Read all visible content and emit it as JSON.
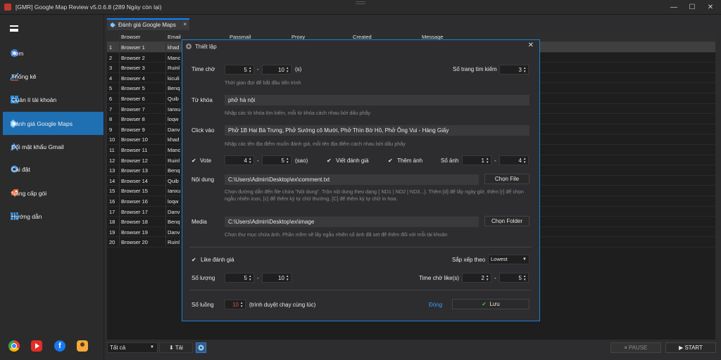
{
  "window": {
    "title": "[GMR] Google Map Review v5.0.6.8 (289 Ngày còn lại)"
  },
  "sidebar": {
    "items": [
      {
        "label": "Xem",
        "icon": "globe-icon"
      },
      {
        "label": "Thống kê",
        "icon": "chart-icon"
      },
      {
        "label": "Quản lí tài khoản",
        "icon": "windows-icon"
      },
      {
        "label": "Đánh giá Google Maps",
        "icon": "maps-icon",
        "active": true
      },
      {
        "label": "Đổi mật khẩu Gmail",
        "icon": "gmail-icon"
      },
      {
        "label": "Cài đặt",
        "icon": "gear-icon"
      },
      {
        "label": "Nâng cấp gói",
        "icon": "tag-icon"
      },
      {
        "label": "Hướng dẫn",
        "icon": "grid-icon"
      }
    ],
    "social": [
      "chrome-icon",
      "youtube-icon",
      "facebook-icon",
      "support-icon"
    ]
  },
  "tab": {
    "label": "Đánh giá Google Maps",
    "close": "×"
  },
  "grid": {
    "columns": [
      "Browser",
      "Email",
      "Passmail",
      "Proxy",
      "Created",
      "Message"
    ],
    "rows": [
      {
        "n": "1",
        "browser": "Browser 1",
        "email": "khad"
      },
      {
        "n": "2",
        "browser": "Browser 2",
        "email": "Manc"
      },
      {
        "n": "3",
        "browser": "Browser 3",
        "email": "Ruinl"
      },
      {
        "n": "4",
        "browser": "Browser 4",
        "email": "kiculi"
      },
      {
        "n": "5",
        "browser": "Browser 5",
        "email": "Benq"
      },
      {
        "n": "6",
        "browser": "Browser 6",
        "email": "Quib"
      },
      {
        "n": "7",
        "browser": "Browser 7",
        "email": "Ianxu"
      },
      {
        "n": "8",
        "browser": "Browser 8",
        "email": "loqw"
      },
      {
        "n": "9",
        "browser": "Browser 9",
        "email": "Danv"
      },
      {
        "n": "10",
        "browser": "Browser 10",
        "email": "khad"
      },
      {
        "n": "11",
        "browser": "Browser 11",
        "email": "Manc"
      },
      {
        "n": "12",
        "browser": "Browser 12",
        "email": "Ruinl"
      },
      {
        "n": "13",
        "browser": "Browser 13",
        "email": "Benq"
      },
      {
        "n": "14",
        "browser": "Browser 14",
        "email": "Quib"
      },
      {
        "n": "15",
        "browser": "Browser 15",
        "email": "Ianxu"
      },
      {
        "n": "16",
        "browser": "Browser 16",
        "email": "loqw"
      },
      {
        "n": "17",
        "browser": "Browser 17",
        "email": "Danv"
      },
      {
        "n": "18",
        "browser": "Browser 18",
        "email": "Benq"
      },
      {
        "n": "19",
        "browser": "Browser 19",
        "email": "Danv"
      },
      {
        "n": "20",
        "browser": "Browser 20",
        "email": "Ruinl"
      }
    ]
  },
  "bottom": {
    "filter_value": "Tất cả",
    "download_label": "⬇  Tải",
    "pause_label": "⏸  PAUSE",
    "start_label": "▶  START"
  },
  "dialog": {
    "title": "Thiết lập",
    "time_wait_label": "Time chờ",
    "time_wait_min": "5",
    "time_wait_max": "10",
    "time_wait_unit": "(s)",
    "time_wait_hint": "Thời gian đợi để bắt đầu tiến trình",
    "search_pages_label": "Số trang tìm kiếm",
    "search_pages_value": "3",
    "keyword_label": "Từ khóa",
    "keyword_value": "phở hà nội",
    "keyword_hint": "Nhập các từ khóa tìm kiếm, mỗi từ khóa cách nhau bởi dấu phẩy",
    "click_label": "Click vào",
    "click_value": "Phở 1B Hai Bà Trưng, Phở Sướng cô Mười, Phở Thìn Bờ Hồ, Phở Ông Vui - Hàng Giấy",
    "click_hint": "Nhập các tên địa điểm muốn đánh giá, mỗi tên địa điểm cách nhau bởi dấu phẩy",
    "vote_label": "Vote",
    "vote_min": "4",
    "vote_max": "5",
    "vote_unit": "(sao)",
    "write_review_label": "Viết đánh giá",
    "add_image_label": "Thêm ảnh",
    "image_count_label": "Số ảnh",
    "image_min": "1",
    "image_max": "4",
    "content_label": "Nội dung",
    "content_path": "C:\\Users\\Admin\\Desktop\\ex\\comment.txt",
    "choose_file_label": "Chọn File",
    "content_hint": "Chọn đường dẫn đến file chứa \"Nội dung\". Trộn nội dung theo dạng { ND1 | ND2 | ND3...}. Thêm [d] để lấy ngày giờ, thêm [r] để chọn ngẫu nhiên icon, [c] để thêm ký tự chữ thường, [C] để thêm ký tự chữ in hoa.",
    "media_label": "Media",
    "media_path": "C:\\Users\\Admin\\Desktop\\ex\\image",
    "choose_folder_label": "Chọn Folder",
    "media_hint": "Chọn thư mục chứa ảnh. Phần mềm sẽ lấy ngẫu nhiên số ảnh đã set để thêm đối với mỗi tài khoản",
    "like_label": "Like đánh giá",
    "sort_label": "Sắp xếp theo",
    "sort_value": "Lowest",
    "qty_label": "Số lượng",
    "qty_min": "5",
    "qty_max": "10",
    "like_wait_label": "Time chờ like(s)",
    "like_wait_min": "2",
    "like_wait_max": "5",
    "threads_label": "Số luồng",
    "threads_value": "10",
    "threads_hint": "(trình duyệt chạy cùng lúc)",
    "close_label": "Đóng",
    "save_label": "Lưu",
    "dash": "-"
  },
  "colors": {
    "accent": "#1f6fb3",
    "border": "#1a7fd4",
    "save_check": "#3cc14a"
  }
}
